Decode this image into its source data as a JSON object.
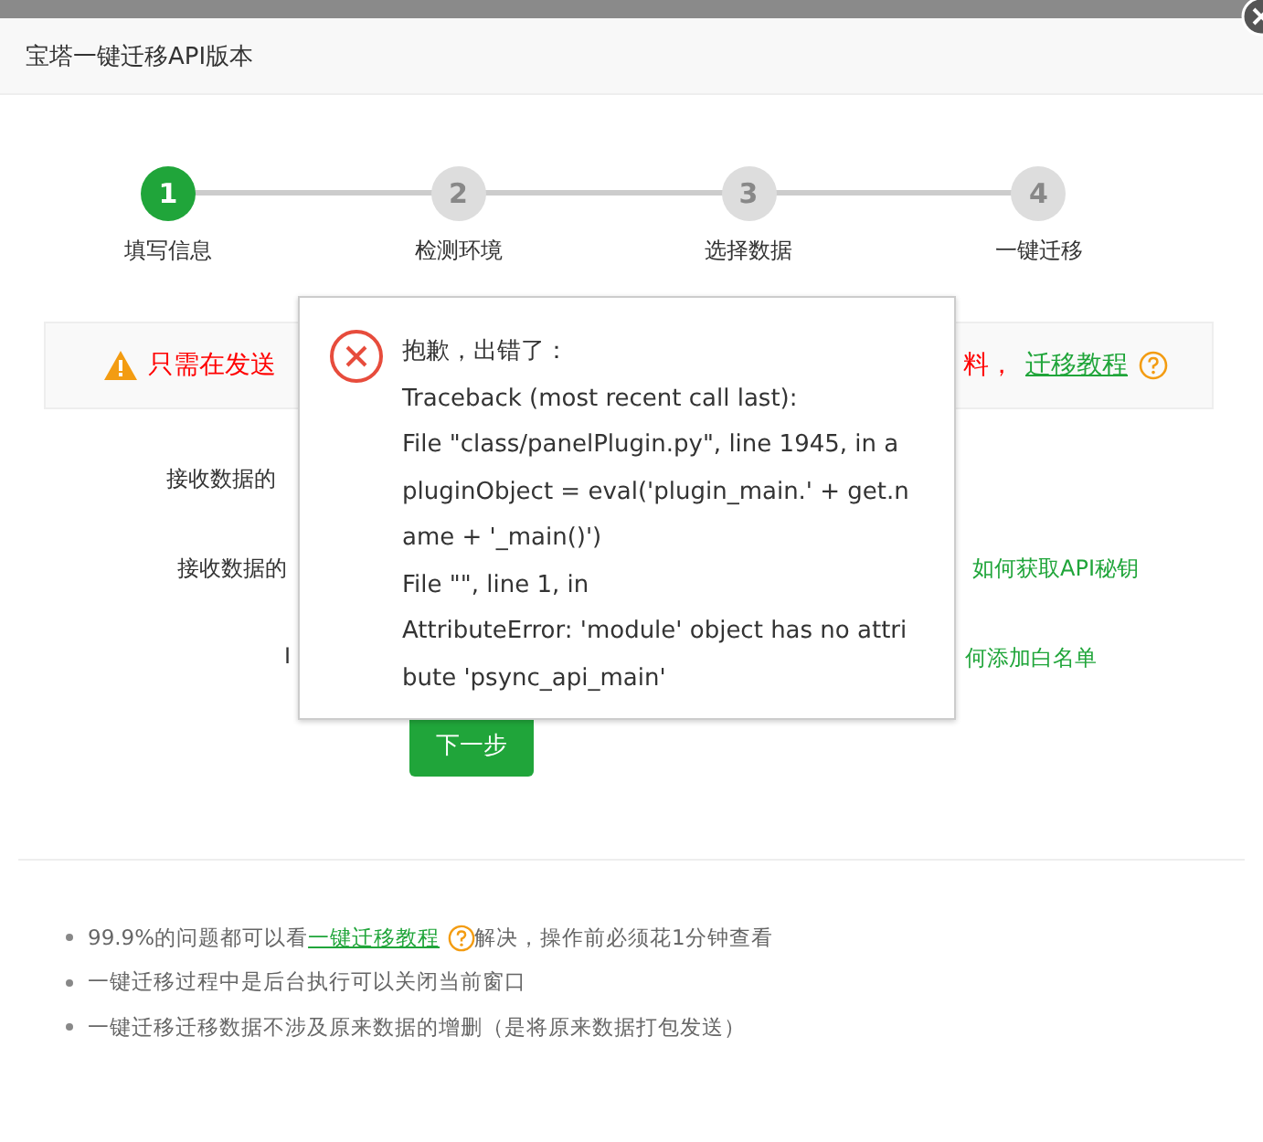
{
  "window": {
    "title": "宝塔一键迁移API版本"
  },
  "steps": [
    {
      "number": "1",
      "label": "填写信息",
      "selected": true
    },
    {
      "number": "2",
      "label": "检测环境",
      "selected": false
    },
    {
      "number": "3",
      "label": "选择数据",
      "selected": false
    },
    {
      "number": "4",
      "label": "一键迁移",
      "selected": false
    }
  ],
  "warning": {
    "text_left": "只需在发送",
    "text_right": "料，",
    "link": "迁移教程"
  },
  "form_rows": [
    {
      "label": "接收数据的",
      "link": ""
    },
    {
      "label": "接收数据的",
      "link": "如何获取API秘钥"
    },
    {
      "label": "I",
      "link": "何添加白名单"
    }
  ],
  "next_button": "下一步",
  "notes": [
    {
      "before": "99.9%的问题都可以看",
      "link": "一键迁移教程",
      "after": "解决，操作前必须花1分钟查看"
    },
    {
      "before": "一键迁移过程中是后台执行可以关闭当前窗口"
    },
    {
      "before": "一键迁移迁移数据不涉及原来数据的增删（是将原来数据打包发送）"
    }
  ],
  "error_dialog": {
    "title": "抱歉，出错了：",
    "lines": [
      "Traceback (most recent call last):",
      "File \"class/panelPlugin.py\", line 1945, in a",
      "pluginObject = eval('plugin_main.' + get.n",
      "ame + '_main()')",
      "File \"\", line 1, in",
      "AttributeError: 'module' object has no attri",
      "bute 'psync_api_main'"
    ]
  }
}
